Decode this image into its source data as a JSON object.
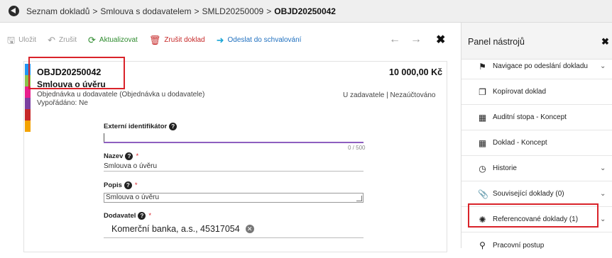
{
  "breadcrumb": {
    "items": [
      "Seznam dokladů",
      "Smlouva s dodavatelem",
      "SMLD20250009"
    ],
    "current": "OBJD20250042",
    "separator": ">"
  },
  "toolbar": {
    "save_label": "Uložit",
    "cancel_label": "Zrušit",
    "refresh_label": "Aktualizovat",
    "cancel_doc_label": "Zrušit doklad",
    "send_label": "Odeslat do schvalování"
  },
  "document": {
    "number": "OBJD20250042",
    "subject": "Smlouva o úvěru",
    "type": "Objednávka u dodavatele (Objednávka u dodavatele)",
    "fulfilled": "Vypořádáno: Ne",
    "amount": "10 000,00 Kč",
    "status": "U zadavatele | Nezaúčtováno",
    "stripe_colors": [
      "#2196f3",
      "#8bc34a",
      "#e91e8c",
      "#7b3fa0",
      "#c62828",
      "#f4a300"
    ]
  },
  "form": {
    "external_id": {
      "label": "Externí identifikátor",
      "value": "",
      "counter": "0 / 500"
    },
    "name": {
      "label": "Nazev",
      "required_mark": "*",
      "value": "Smlouva o úvěru"
    },
    "description": {
      "label": "Popis",
      "required_mark": "*",
      "value": "Smlouva o úvěru"
    },
    "supplier": {
      "label": "Dodavatel",
      "required_mark": "*",
      "value": "Komerční banka, a.s., 45317054"
    }
  },
  "panel": {
    "title": "Panel nástrojů",
    "items": [
      {
        "label": "Navigace po odeslání dokladu",
        "icon": "navigation-icon",
        "expandable": true
      },
      {
        "label": "Kopírovat doklad",
        "icon": "copy-icon",
        "expandable": false
      },
      {
        "label": "Auditní stopa - Koncept",
        "icon": "pdf-icon",
        "expandable": false
      },
      {
        "label": "Doklad - Koncept",
        "icon": "pdf-icon",
        "expandable": false
      },
      {
        "label": "Historie",
        "icon": "clock-icon",
        "expandable": true
      },
      {
        "label": "Související doklady (0)",
        "icon": "paperclip-icon",
        "expandable": true
      },
      {
        "label": "Referencované doklady (1)",
        "icon": "network-icon",
        "expandable": true
      },
      {
        "label": "Pracovní postup",
        "icon": "share-icon",
        "expandable": false
      }
    ]
  },
  "colors": {
    "highlight": "#d9232a",
    "accent_purple": "#7b3fa0",
    "green": "#2e8b2e",
    "red": "#c62828",
    "blue": "#1e6fbf"
  }
}
